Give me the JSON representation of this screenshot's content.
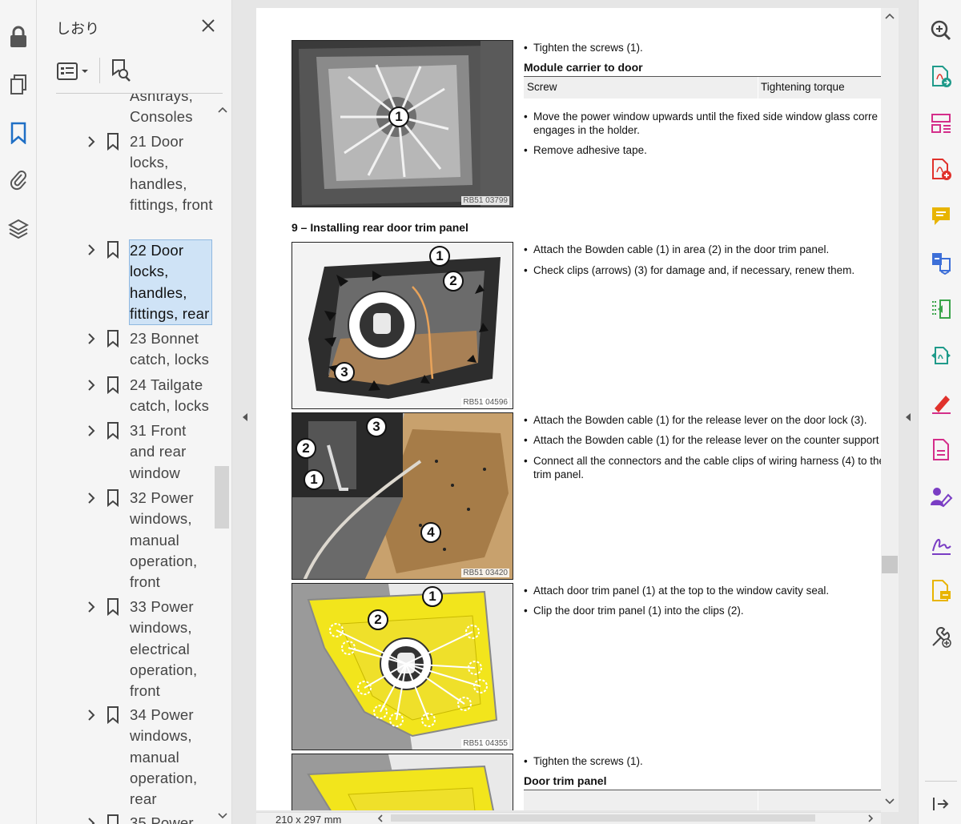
{
  "sidebar": {
    "title": "しおり",
    "bookmarks": [
      {
        "label": "Ashtrays, Consoles",
        "partial": true
      },
      {
        "label": "21 Door locks, handles, fittings, front"
      },
      {
        "label": "22 Door locks, handles, fittings, rear",
        "selected": true
      },
      {
        "label": "23 Bonnet catch, locks"
      },
      {
        "label": "24 Tailgate catch, locks"
      },
      {
        "label": "31 Front and rear window"
      },
      {
        "label": "32 Power windows, manual operation, front"
      },
      {
        "label": "33 Power windows, electrical operation, front"
      },
      {
        "label": "34 Power windows, manual operation, rear"
      },
      {
        "label": "35 Power"
      }
    ]
  },
  "document": {
    "page_size": "210 x 297 mm",
    "fig1": {
      "caption": "RB51 03799",
      "callouts": [
        "1"
      ]
    },
    "fig2": {
      "caption": "RB51 04596",
      "callouts": [
        "1",
        "2",
        "3"
      ]
    },
    "fig3": {
      "caption": "RB51 03420",
      "callouts": [
        "3",
        "2",
        "1",
        "4"
      ]
    },
    "fig4": {
      "caption": "RB51 04355",
      "callouts": [
        "1",
        "2"
      ]
    },
    "block1": {
      "bullet1": "Tighten the screws (1).",
      "heading": "Module carrier to door",
      "table": {
        "col1": "Screw",
        "col2": "Tightening torque"
      },
      "bullet2a": "Move the power window upwards until the fixed side window glass corre",
      "bullet2b": "engages in the holder.",
      "bullet3": "Remove adhesive tape."
    },
    "section_title": "9 – Installing rear door trim panel",
    "block2": {
      "bullet1": "Attach the Bowden cable (1) in area (2) in the door trim panel.",
      "bullet2": "Check clips (arrows) (3) for damage and, if necessary, renew them."
    },
    "block3": {
      "bullet1": "Attach the Bowden cable (1) for the release lever on the door lock (3).",
      "bullet2": "Attach the Bowden cable (1) for the release lever on the counter support",
      "bullet3a": "Connect all the connectors and the cable clips of wiring harness (4) to the",
      "bullet3b": "trim panel."
    },
    "block4": {
      "bullet1": "Attach door trim panel (1) at the top to the window cavity seal.",
      "bullet2": "Clip the door trim panel (1) into the clips (2)."
    },
    "block5": {
      "bullet1": "Tighten the screws (1).",
      "heading": "Door trim panel"
    }
  },
  "colors": {
    "accent_blue": "#1f6fc5",
    "tool_red": "#e0312b",
    "tool_pink": "#d42e8a",
    "tool_green": "#3aa44a",
    "tool_yellow": "#e8b400",
    "tool_purple": "#7a3dc4"
  }
}
